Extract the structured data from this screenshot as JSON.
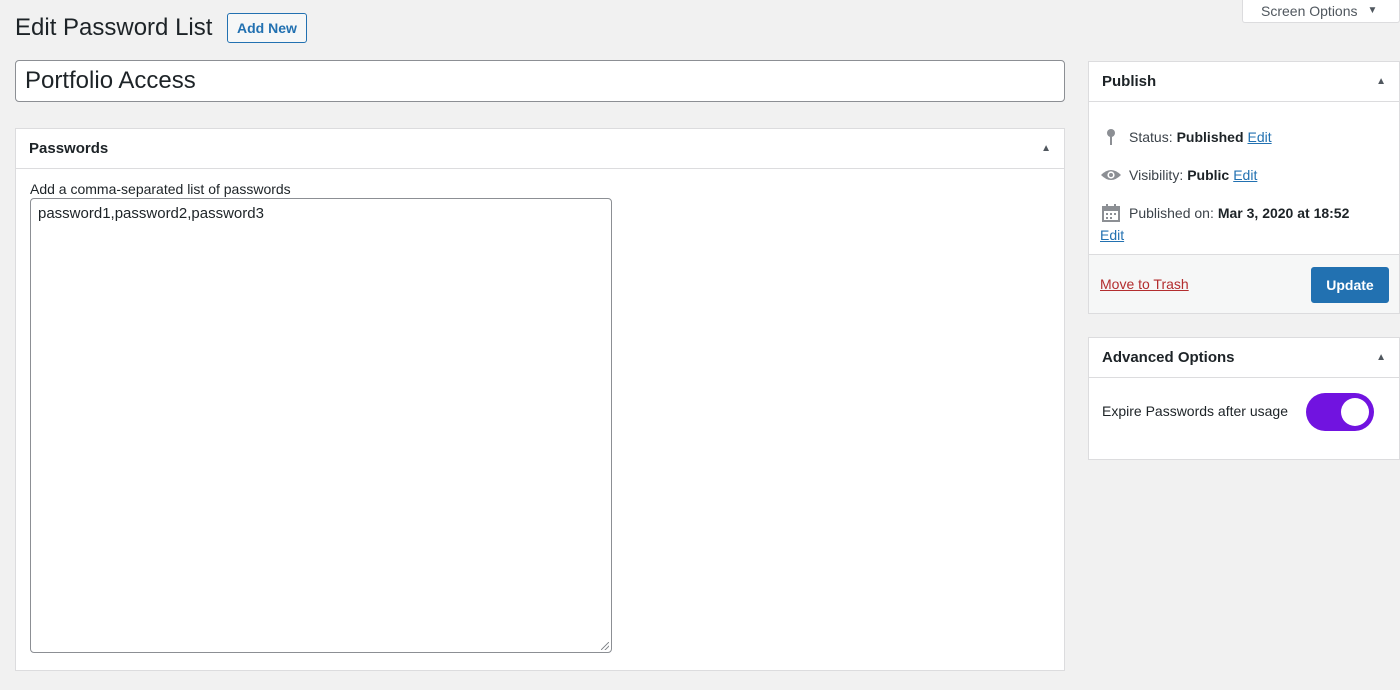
{
  "header": {
    "screen_options_label": "Screen Options",
    "page_title": "Edit Password List",
    "add_new_label": "Add New"
  },
  "post_title": "Portfolio Access",
  "passwords_box": {
    "title": "Passwords",
    "label": "Add a comma-separated list of passwords",
    "value": "password1,password2,password3"
  },
  "publish_box": {
    "title": "Publish",
    "status_label": "Status:",
    "status_value": "Published",
    "visibility_label": "Visibility:",
    "visibility_value": "Public",
    "published_on_label": "Published on:",
    "published_on_value": "Mar 3, 2020 at 18:52",
    "edit_label": "Edit",
    "trash_label": "Move to Trash",
    "update_label": "Update"
  },
  "advanced_box": {
    "title": "Advanced Options",
    "expire_label": "Expire Passwords after usage",
    "expire_enabled": true,
    "toggle_color": "#7113e0"
  },
  "colors": {
    "accent": "#2271b1",
    "trash": "#b32d2e",
    "background": "#f1f1f1"
  }
}
